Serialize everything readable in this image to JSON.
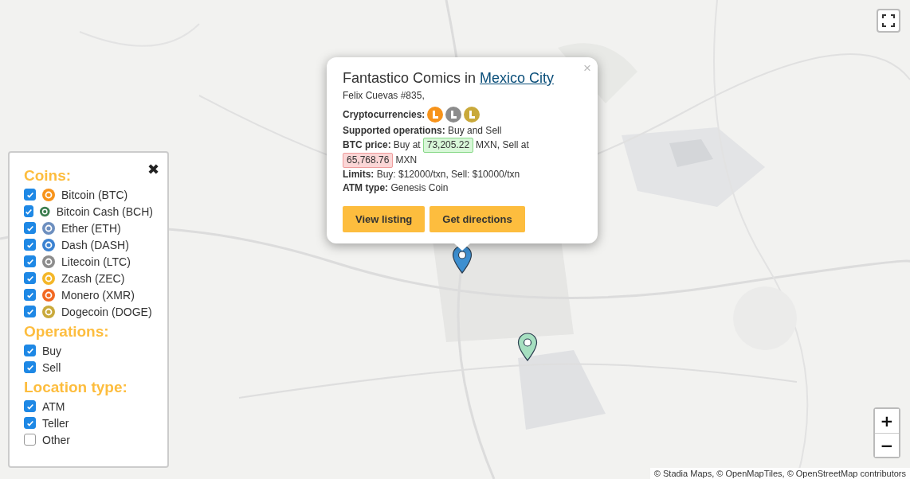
{
  "zoom": {
    "in": "+",
    "out": "−"
  },
  "attribution": "© Stadia Maps, © OpenMapTiles, © OpenStreetMap contributors",
  "markers": [
    {
      "color": "#3d8fd0"
    },
    {
      "color": "#a6dfc0"
    }
  ],
  "popup": {
    "close": "×",
    "title": "Fantastico Comics in ",
    "city": "Mexico City",
    "address": "Felix Cuevas #835,",
    "crypto_label": "Cryptocurrencies:",
    "coins": [
      {
        "color": "#f7931a"
      },
      {
        "color": "#8c8c8c"
      },
      {
        "color": "#c9a93a"
      }
    ],
    "operations": "**Supported operations:** Buy and Sell",
    "price_label": "BTC price:",
    "buy_text": "Buy at",
    "buy_price": "73,205.22",
    "mid_text": "MXN, Sell at",
    "sell_price": "65,768.76",
    "end_text": "MXN",
    "limits": "**Limits:** Buy: $12000/txn, Sell: $10000/txn",
    "atm_type": "**ATM type:** Genesis Coin",
    "buttons": [
      "View listing",
      "Get directions"
    ]
  },
  "filters": {
    "close": "✖",
    "sections": [
      {
        "title": "Coins:",
        "items": [
          {
            "label": "Bitcoin (BTC)",
            "checked": true,
            "color": "#f7931a"
          },
          {
            "label": "Bitcoin Cash (BCH)",
            "checked": true,
            "color": "#3b7d4f"
          },
          {
            "label": "Ether (ETH)",
            "checked": true,
            "color": "#6d8fbf"
          },
          {
            "label": "Dash (DASH)",
            "checked": true,
            "color": "#3b82d1"
          },
          {
            "label": "Litecoin (LTC)",
            "checked": true,
            "color": "#8c8c8c"
          },
          {
            "label": "Zcash (ZEC)",
            "checked": true,
            "color": "#f4b728"
          },
          {
            "label": "Monero (XMR)",
            "checked": true,
            "color": "#f26822"
          },
          {
            "label": "Dogecoin (DOGE)",
            "checked": true,
            "color": "#c9a93a"
          }
        ]
      },
      {
        "title": "Operations:",
        "items": [
          {
            "label": "Buy",
            "checked": true
          },
          {
            "label": "Sell",
            "checked": true
          }
        ]
      },
      {
        "title": "Location type:",
        "items": [
          {
            "label": "ATM",
            "checked": true
          },
          {
            "label": "Teller",
            "checked": true
          },
          {
            "label": "Other",
            "checked": false
          }
        ]
      }
    ]
  }
}
